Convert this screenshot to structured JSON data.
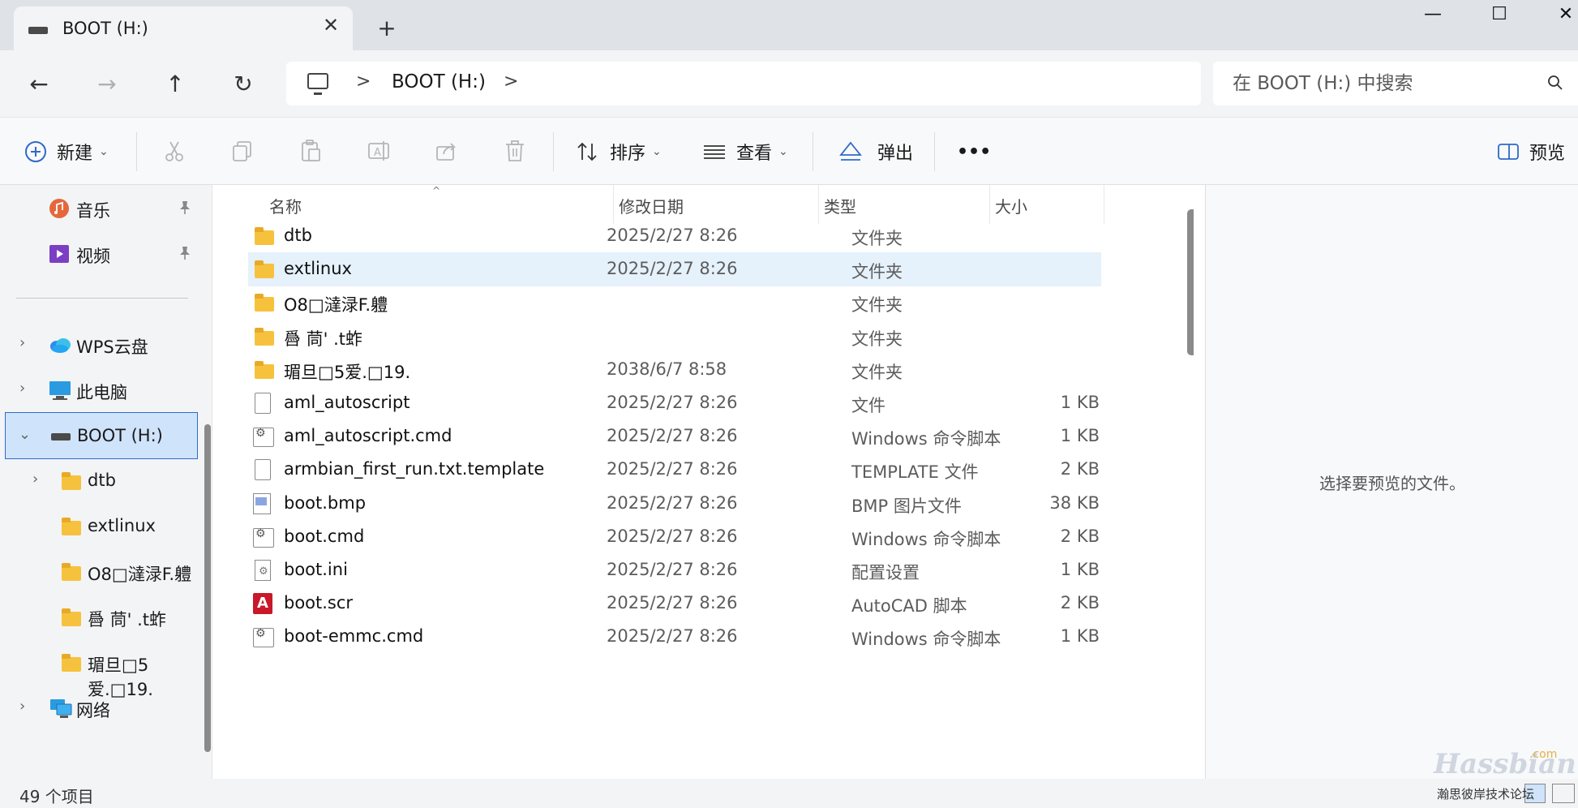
{
  "tab": {
    "title": "BOOT (H:)",
    "new_tab": "+"
  },
  "window_controls": {
    "minimize": "—",
    "maximize": "☐",
    "close": "✕"
  },
  "nav": {
    "back": "←",
    "forward": "→",
    "up": "↑",
    "refresh": "↻"
  },
  "address": {
    "crumbs": [
      "BOOT (H:)"
    ],
    "separator": ">"
  },
  "search": {
    "placeholder": "在 BOOT (H:) 中搜索"
  },
  "toolbar": {
    "new_label": "新建",
    "sort_label": "排序",
    "view_label": "查看",
    "eject_label": "弹出",
    "more_label": "•••",
    "preview_label": "预览"
  },
  "sidebar": {
    "quick": [
      {
        "label": "音乐"
      },
      {
        "label": "视频"
      }
    ],
    "roots": [
      {
        "label": "WPS云盘"
      },
      {
        "label": "此电脑"
      },
      {
        "label": "BOOT (H:)"
      }
    ],
    "boot_children": [
      {
        "label": "dtb"
      },
      {
        "label": "extlinux"
      },
      {
        "label": "O8□澾渌F.軆"
      },
      {
        "label": "噕  茼'  .t蚱"
      },
      {
        "label": "瑂旦□5爱.□19."
      }
    ],
    "network": {
      "label": "网络"
    }
  },
  "columns": {
    "name": "名称",
    "date": "修改日期",
    "type": "类型",
    "size": "大小"
  },
  "files": [
    {
      "name": "dtb",
      "date": "2025/2/27 8:26",
      "type": "文件夹",
      "size": "",
      "icon": "folder-icon"
    },
    {
      "name": "extlinux",
      "date": "2025/2/27 8:26",
      "type": "文件夹",
      "size": "",
      "icon": "folder-icon"
    },
    {
      "name": "O8□澾渌F.軆",
      "date": "",
      "type": "文件夹",
      "size": "",
      "icon": "folder-icon"
    },
    {
      "name": "噕  茼'  .t蚱",
      "date": "",
      "type": "文件夹",
      "size": "",
      "icon": "folder-icon"
    },
    {
      "name": "瑂旦□5爱.□19.",
      "date": "2038/6/7 8:58",
      "type": "文件夹",
      "size": "",
      "icon": "folder-icon"
    },
    {
      "name": "aml_autoscript",
      "date": "2025/2/27 8:26",
      "type": "文件",
      "size": "1 KB",
      "icon": "file-icon"
    },
    {
      "name": "aml_autoscript.cmd",
      "date": "2025/2/27 8:26",
      "type": "Windows 命令脚本",
      "size": "1 KB",
      "icon": "cmd-file-icon"
    },
    {
      "name": "armbian_first_run.txt.template",
      "date": "2025/2/27 8:26",
      "type": "TEMPLATE 文件",
      "size": "2 KB",
      "icon": "file-icon"
    },
    {
      "name": "boot.bmp",
      "date": "2025/2/27 8:26",
      "type": "BMP 图片文件",
      "size": "38 KB",
      "icon": "bmp-file-icon"
    },
    {
      "name": "boot.cmd",
      "date": "2025/2/27 8:26",
      "type": "Windows 命令脚本",
      "size": "2 KB",
      "icon": "cmd-file-icon"
    },
    {
      "name": "boot.ini",
      "date": "2025/2/27 8:26",
      "type": "配置设置",
      "size": "1 KB",
      "icon": "ini-file-icon"
    },
    {
      "name": "boot.scr",
      "date": "2025/2/27 8:26",
      "type": "AutoCAD 脚本",
      "size": "2 KB",
      "icon": "autocad-file-icon"
    },
    {
      "name": "boot-emmc.cmd",
      "date": "2025/2/27 8:26",
      "type": "Windows 命令脚本",
      "size": "1 KB",
      "icon": "cmd-file-icon"
    }
  ],
  "selected_row": 1,
  "preview": {
    "message": "选择要预览的文件。"
  },
  "status": {
    "count": "49 个项目"
  },
  "watermark": {
    "brand": "Hassbian",
    "com": ".com",
    "sub": "瀚思彼岸技术论坛"
  },
  "colors": {
    "accent": "#2f6ac7",
    "selection": "#e5f1fb",
    "folder": "#f6c23e"
  }
}
